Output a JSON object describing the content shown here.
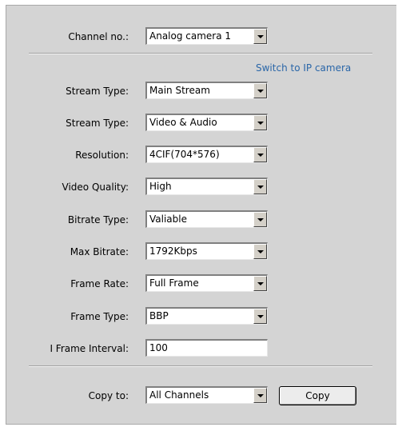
{
  "channel": {
    "label": "Channel no.:",
    "value": "Analog camera 1"
  },
  "switch_link": "Switch to IP camera",
  "settings": [
    {
      "label": "Stream Type:",
      "value": "Main Stream"
    },
    {
      "label": "Stream Type:",
      "value": "Video & Audio"
    },
    {
      "label": "Resolution:",
      "value": "4CIF(704*576)"
    },
    {
      "label": "Video Quality:",
      "value": "High"
    },
    {
      "label": "Bitrate Type:",
      "value": "Valiable"
    },
    {
      "label": "Max Bitrate:",
      "value": "1792Kbps"
    },
    {
      "label": "Frame Rate:",
      "value": "Full Frame"
    },
    {
      "label": "Frame Type:",
      "value": "BBP"
    }
  ],
  "iframe": {
    "label": "I Frame Interval:",
    "value": "100"
  },
  "copy": {
    "label": "Copy to:",
    "value": "All Channels",
    "button": "Copy"
  }
}
